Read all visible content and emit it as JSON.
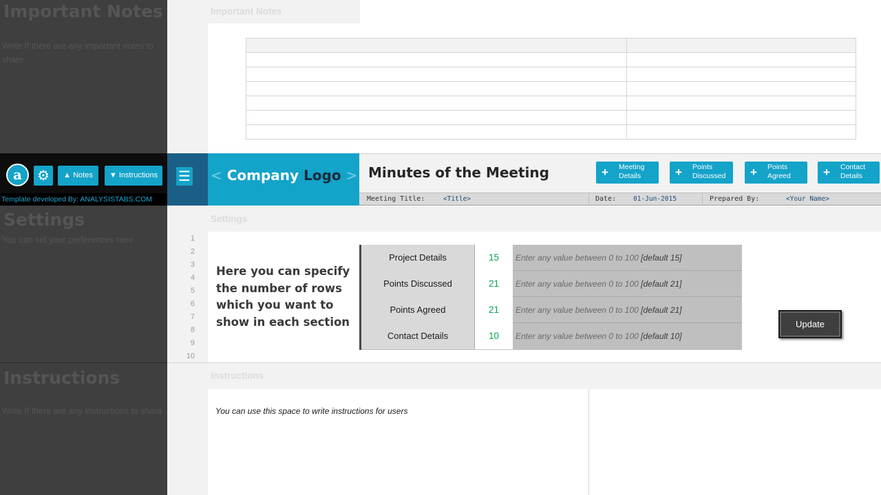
{
  "left_panel": {
    "notes_heading": "Important Notes",
    "notes_sub": "Write If there are any important notes to share",
    "settings_heading": "Settings",
    "settings_sub": "You can set your preferences here",
    "instructions_heading": "Instructions",
    "instructions_sub": "Write If there are any Instructions to share"
  },
  "sections": {
    "notes_label": "Important Notes",
    "settings_label": "Settings",
    "instructions_label": "Instructions"
  },
  "toolbar": {
    "logo_glyph": "a",
    "notes_label": "▲ Notes",
    "instructions_label": "▼ Instructions",
    "credit": "Template developed By: ANALYSISTABS.COM",
    "hamburger_glyph": "☰"
  },
  "header": {
    "company_prefix": "Company",
    "company_logo_word": "Logo",
    "chevron_left": "<",
    "chevron_right": ">",
    "title": "Minutes of the Meeting",
    "nav_buttons": [
      {
        "plus": "+",
        "label": "Meeting Details"
      },
      {
        "plus": "+",
        "label": "Points Discussed"
      },
      {
        "plus": "+",
        "label": "Points Agreed"
      },
      {
        "plus": "+",
        "label": "Contact Details"
      }
    ]
  },
  "meta": {
    "meeting_title_label": "Meeting Title:",
    "meeting_title_value": "<Title>",
    "date_label": "Date:",
    "date_value": "01-Jun-2015",
    "prepared_label": "Prepared By:",
    "prepared_value": "<Your Name>"
  },
  "settings": {
    "description": "Here you can specify the number of rows which you want  to show in each section",
    "row_numbers": [
      "1",
      "2",
      "3",
      "4",
      "5",
      "6",
      "7",
      "8",
      "9",
      "10"
    ],
    "rows": [
      {
        "name": "Project Details",
        "value": "15",
        "hint": "Enter any value between 0 to 100",
        "default": "[default 15]"
      },
      {
        "name": "Points Discussed",
        "value": "21",
        "hint": "Enter any value between 0 to 100",
        "default": "[default 21]"
      },
      {
        "name": "Points Agreed",
        "value": "21",
        "hint": "Enter any value between 0 to 100",
        "default": "[default 21]"
      },
      {
        "name": "Contact Details",
        "value": "10",
        "hint": "Enter any value between 0 to 100",
        "default": "[default 10]"
      }
    ],
    "update_label": "Update"
  },
  "instructions": {
    "text": "You can use this space to write instructions for users"
  },
  "colors": {
    "accent": "#14a3c9",
    "dark_panel": "#3f3f3f",
    "value_green": "#00a650"
  }
}
